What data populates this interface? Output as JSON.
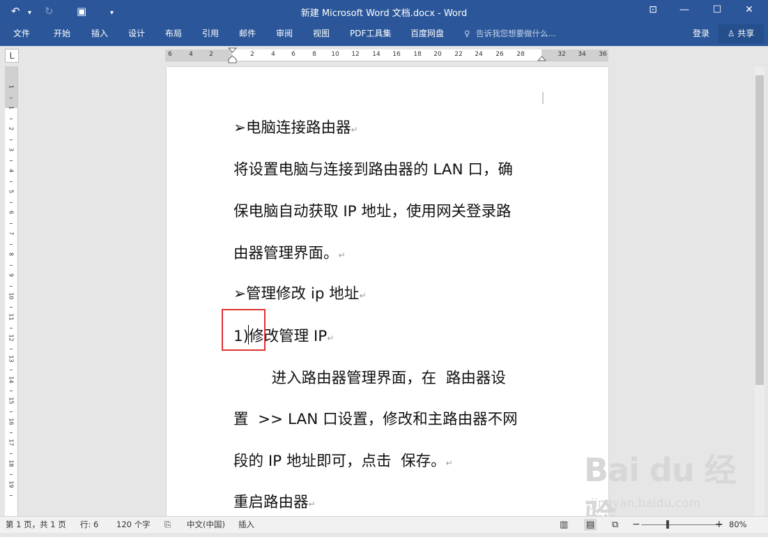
{
  "titlebar": {
    "title": "新建 Microsoft Word 文档.docx - Word",
    "undo_icon": "↶",
    "dropdown_icon": "▾",
    "redo_icon": "↻",
    "save_icon": "▣",
    "customize_icon": "▾",
    "ribbon_display_icon": "⊡",
    "minimize_icon": "—",
    "maximize_icon": "☐",
    "close_icon": "✕"
  },
  "ribbon": {
    "tabs": [
      "文件",
      "开始",
      "插入",
      "设计",
      "布局",
      "引用",
      "邮件",
      "审阅",
      "视图",
      "PDF工具集",
      "百度网盘"
    ],
    "tell_me_icon": "♀",
    "tell_me": "告诉我您想要做什么...",
    "login": "登录",
    "share": "共享",
    "share_icon": "♙"
  },
  "ruler": {
    "corner": "L",
    "h_numbers": [
      "6",
      "4",
      "2",
      "2",
      "4",
      "6",
      "8",
      "10",
      "12",
      "14",
      "16",
      "18",
      "20",
      "22",
      "24",
      "26",
      "28",
      "32",
      "34",
      "36"
    ],
    "v_numbers": [
      "1",
      "1",
      "2",
      "3",
      "4",
      "5",
      "6",
      "7",
      "8",
      "9",
      "10",
      "11",
      "12",
      "13",
      "14",
      "15",
      "16",
      "17",
      "18",
      "19"
    ]
  },
  "document": {
    "lines": [
      "➢电脑连接路由器",
      "将设置电脑与连接到路由器的 LAN 口，确",
      "保电脑自动获取 IP 地址，使用网关登录路",
      "由器管理界面。",
      "➢管理修改 ip 地址",
      "1)修改管理 IP",
      "        进入路由器管理界面，在  路由器设",
      "置  >> LAN 口设置，修改和主路由器不网",
      "段的 IP 地址即可，点击  保存。",
      "重启路由器"
    ],
    "paragraph_mark": "↵"
  },
  "statusbar": {
    "page": "第 1 页，共 1 页",
    "row": "行: 6",
    "words": "120 个字",
    "proof_icon": "⎘",
    "language": "中文(中国)",
    "insert_mode": "插入",
    "read_mode_icon": "▥",
    "print_layout_icon": "▤",
    "web_layout_icon": "⧉",
    "zoom_out": "−",
    "zoom_in": "+",
    "zoom": "80%",
    "zoom_level": 0.8
  },
  "watermark": {
    "logo_text": "Bai du 经验",
    "url": "jingyan.baidu.com"
  }
}
